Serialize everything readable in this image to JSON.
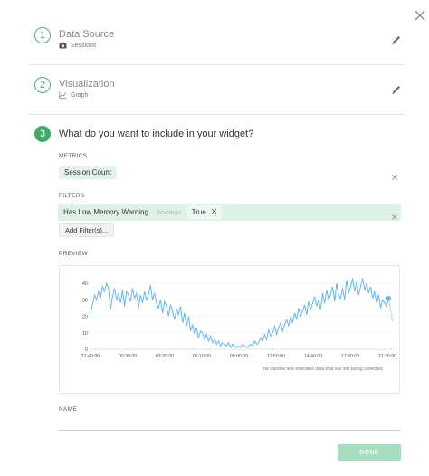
{
  "steps": [
    {
      "number": "1",
      "title": "Data Source",
      "subtitle": "Sessions",
      "icon": "camera-icon"
    },
    {
      "number": "2",
      "title": "Visualization",
      "subtitle": "Graph",
      "icon": "line-chart-icon"
    },
    {
      "number": "3",
      "title": "What do you want to include in your widget?"
    }
  ],
  "metrics": {
    "label": "METRICS",
    "chip": "Session Count"
  },
  "filters": {
    "label": "FILTERS",
    "field": "Has Low Memory Warning",
    "type": "boolean",
    "value": "True",
    "add_button": "Add Filter(s)..."
  },
  "preview": {
    "label": "PREVIEW",
    "note": "The dashed line indicates data that are still being collected."
  },
  "name": {
    "label": "NAME",
    "value": ""
  },
  "done_button": "DONE",
  "colors": {
    "accent": "#3fa96b",
    "line": "#64b5f6",
    "chip_bg": "#e4f3ea",
    "done_bg": "#a8dcc0"
  },
  "chart_data": {
    "type": "line",
    "y_ticks": [
      0,
      10,
      20,
      30,
      40
    ],
    "ylim": [
      0,
      45
    ],
    "x_tick_labels": [
      "21:40:00",
      "00:30:00",
      "03:20:00",
      "06:10:00",
      "09:00:00",
      "11:50:00",
      "14:40:00",
      "17:30:00",
      "21:20:00"
    ],
    "series": [
      {
        "values": [
          22,
          27,
          33,
          30,
          35,
          31,
          38,
          35,
          40,
          37,
          24,
          32,
          37,
          30,
          34,
          28,
          36,
          26,
          35,
          33,
          29,
          37,
          31,
          34,
          25,
          33,
          28,
          35,
          30,
          33,
          39,
          30,
          34,
          28,
          25,
          30,
          22,
          29,
          26,
          20,
          27,
          23,
          18,
          24,
          21,
          26,
          16,
          22,
          14,
          20,
          11,
          15,
          9,
          13,
          7,
          11,
          10,
          6,
          9,
          5,
          8,
          4,
          6,
          3,
          5,
          2,
          4,
          3,
          2,
          4,
          1,
          3,
          2,
          1,
          2,
          1,
          3,
          2,
          1,
          2,
          3,
          2,
          5,
          3,
          4,
          7,
          5,
          9,
          6,
          12,
          8,
          10,
          14,
          9,
          13,
          16,
          11,
          15,
          18,
          14,
          20,
          16,
          22,
          18,
          25,
          20,
          23,
          27,
          21,
          29,
          24,
          28,
          32,
          26,
          30,
          24,
          34,
          28,
          36,
          30,
          33,
          38,
          29,
          40,
          33,
          31,
          37,
          30,
          42,
          34,
          38,
          43,
          35,
          41,
          33,
          38,
          43,
          36,
          40,
          34,
          38,
          31,
          35,
          28,
          33,
          25,
          30,
          28,
          26,
          31
        ]
      },
      {
        "values": [
          31,
          24,
          17
        ]
      }
    ]
  }
}
